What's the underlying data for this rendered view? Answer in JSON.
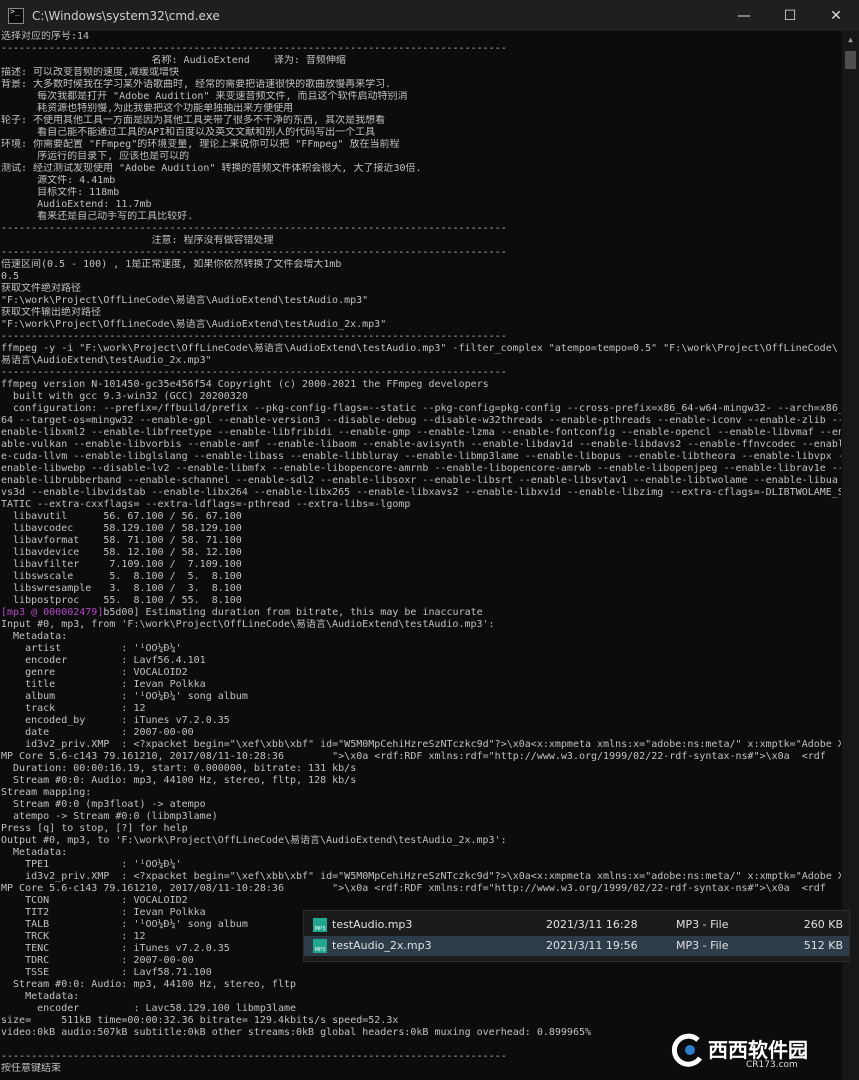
{
  "window": {
    "title": "C:\\Windows\\system32\\cmd.exe",
    "minimize": "—",
    "maximize": "☐",
    "close": "✕"
  },
  "console": {
    "lines": [
      "选择对应的序号:14",
      "------------------------------------------------------------------------------------",
      "                         名称: AudioExtend    译为: 音频伸缩",
      "描述: 可以改变音频的速度,减缓或增快",
      "背景: 大多数时候我在学习某外语歌曲时, 经常的需要把语速很快的歌曲放慢再来学习.",
      "      每次我都是打开 \"Adobe Audition\" 来变速音频文件, 而且这个软件启动特别消",
      "      耗资源也特别慢,为此我要把这个功能单独抽出来方便使用",
      "轮子: 不使用其他工具一方面是因为其他工具夹带了很多不干净的东西, 其次是我想看",
      "      看自己能不能通过工具的API和百度以及英文文献和别人的代码写出一个工具",
      "环境: 你需要配置 \"FFmpeg\"的环境变量, 理论上来说你可以把 \"FFmpeg\" 放在当前程",
      "      序运行的目录下, 应该也是可以的",
      "测试: 经过测试发现使用 \"Adobe Audition\" 转换的音频文件体积会很大, 大了接近30倍.",
      "      源文件: 4.41mb",
      "      目标文件: 118mb",
      "      AudioExtend: 11.7mb",
      "      看来还是自己动手写的工具比较好.",
      "------------------------------------------------------------------------------------",
      "                         注意: 程序没有做容错处理",
      "------------------------------------------------------------------------------------",
      "倍速区间(0.5 - 100) , 1是正常速度, 如果你依然转换了文件会增大1mb",
      "0.5",
      "获取文件绝对路径",
      "\"F:\\work\\Project\\OffLineCode\\易语言\\AudioExtend\\testAudio.mp3\"",
      "获取文件输出绝对路径",
      "\"F:\\work\\Project\\OffLineCode\\易语言\\AudioExtend\\testAudio_2x.mp3\"",
      "------------------------------------------------------------------------------------",
      "ffmpeg -y -i \"F:\\work\\Project\\OffLineCode\\易语言\\AudioExtend\\testAudio.mp3\" -filter_complex \"atempo=tempo=0.5\" \"F:\\work\\Project\\OffLineCode\\",
      "易语言\\AudioExtend\\testAudio_2x.mp3\"",
      "------------------------------------------------------------------------------------",
      "ffmpeg version N-101450-gc35e456f54 Copyright (c) 2000-2021 the FFmpeg developers",
      "  built with gcc 9.3-win32 (GCC) 20200320",
      "  configuration: --prefix=/ffbuild/prefix --pkg-config-flags=--static --pkg-config=pkg-config --cross-prefix=x86_64-w64-mingw32- --arch=x86_",
      "64 --target-os=mingw32 --enable-gpl --enable-version3 --disable-debug --disable-w32threads --enable-pthreads --enable-iconv --enable-zlib --",
      "enable-libxml2 --enable-libfreetype --enable-libfribidi --enable-gmp --enable-lzma --enable-fontconfig --enable-opencl --enable-libvmaf --en",
      "able-vulkan --enable-libvorbis --enable-amf --enable-libaom --enable-avisynth --enable-libdav1d --enable-libdavs2 --enable-ffnvcodec --enabl",
      "e-cuda-llvm --enable-libglslang --enable-libass --enable-libbluray --enable-libmp3lame --enable-libopus --enable-libtheora --enable-libvpx --",
      "enable-libwebp --disable-lv2 --enable-libmfx --enable-libopencore-amrnb --enable-libopencore-amrwb --enable-libopenjpeg --enable-librav1e --",
      "enable-librubberband --enable-schannel --enable-sdl2 --enable-libsoxr --enable-libsrt --enable-libsvtav1 --enable-libtwolame --enable-libua",
      "vs3d --enable-libvidstab --enable-libx264 --enable-libx265 --enable-libxavs2 --enable-libxvid --enable-libzimg --extra-cflags=-DLIBTWOLAME_S",
      "TATIC --extra-cxxflags= --extra-ldflags=-pthread --extra-libs=-lgomp",
      "  libavutil      56. 67.100 / 56. 67.100",
      "  libavcodec     58.129.100 / 58.129.100",
      "  libavformat    58. 71.100 / 58. 71.100",
      "  libavdevice    58. 12.100 / 58. 12.100",
      "  libavfilter     7.109.100 /  7.109.100",
      "  libswscale      5.  8.100 /  5.  8.100",
      "  libswresample   3.  8.100 /  3.  8.100",
      "  libpostproc    55.  8.100 / 55.  8.100",
      "[mp3 @ 000002479]b5d00] Estimating duration from bitrate, this may be inaccurate",
      "Input #0, mp3, from 'F:\\work\\Project\\OffLineCode\\易语言\\AudioExtend\\testAudio.mp3':",
      "  Metadata:",
      "    artist          : '¹ÓÖ¼Ð¼'",
      "    encoder         : Lavf56.4.101",
      "    genre           : VOCALOID2",
      "    title           : Ievan Polkka",
      "    album           : '¹ÓÖ¼Ð¼' song album",
      "    track           : 12",
      "    encoded_by      : iTunes v7.2.0.35",
      "    date            : 2007-00-00",
      "    id3v2_priv.XMP  : <?xpacket begin=\"\\xef\\xbb\\xbf\" id=\"W5M0MpCehiHzreSzNTczkc9d\"?>\\x0a<x:xmpmeta xmlns:x=\"adobe:ns:meta/\" x:xmptk=\"Adobe X",
      "MP Core 5.6-c143 79.161210, 2017/08/11-10:28:36        \">\\x0a <rdf:RDF xmlns:rdf=\"http://www.w3.org/1999/02/22-rdf-syntax-ns#\">\\x0a  <rdf",
      "  Duration: 00:00:16.19, start: 0.000000, bitrate: 131 kb/s",
      "  Stream #0:0: Audio: mp3, 44100 Hz, stereo, fltp, 128 kb/s",
      "Stream mapping:",
      "  Stream #0:0 (mp3float) -> atempo",
      "  atempo -> Stream #0:0 (libmp3lame)",
      "Press [q] to stop, [?] for help",
      "Output #0, mp3, to 'F:\\work\\Project\\OffLineCode\\易语言\\AudioExtend\\testAudio_2x.mp3':",
      "  Metadata:",
      "    TPE1            : '¹ÓÖ¼Ð¼'",
      "    id3v2_priv.XMP  : <?xpacket begin=\"\\xef\\xbb\\xbf\" id=\"W5M0MpCehiHzreSzNTczkc9d\"?>\\x0a<x:xmpmeta xmlns:x=\"adobe:ns:meta/\" x:xmptk=\"Adobe X",
      "MP Core 5.6-c143 79.161210, 2017/08/11-10:28:36        \">\\x0a <rdf:RDF xmlns:rdf=\"http://www.w3.org/1999/02/22-rdf-syntax-ns#\">\\x0a  <rdf",
      "    TCON            : VOCALOID2",
      "    TIT2            : Ievan Polkka",
      "    TALB            : '¹ÓÖ¼Ð¼' song album",
      "    TRCK            : 12",
      "    TENC            : iTunes v7.2.0.35",
      "    TDRC            : 2007-00-00",
      "    TSSE            : Lavf58.71.100",
      "  Stream #0:0: Audio: mp3, 44100 Hz, stereo, fltp",
      "    Metadata:",
      "      encoder         : Lavc58.129.100 libmp3lame",
      "size=     511kB time=00:00:32.36 bitrate= 129.4kbits/s speed=52.3x",
      "video:0kB audio:507kB subtitle:0kB other streams:0kB global headers:0kB muxing overhead: 0.899965%",
      "",
      "------------------------------------------------------------------------------------",
      "按任意键结束"
    ]
  },
  "files": {
    "rows": [
      {
        "name": "testAudio.mp3",
        "date": "2021/3/11 16:28",
        "type": "MP3 - File",
        "size": "260 KB"
      },
      {
        "name": "testAudio_2x.mp3",
        "date": "2021/3/11 19:56",
        "type": "MP3 - File",
        "size": "512 KB"
      }
    ],
    "icon_label": "MP3"
  },
  "watermark": {
    "text": "西西软件园",
    "sub": "CR173.com"
  }
}
